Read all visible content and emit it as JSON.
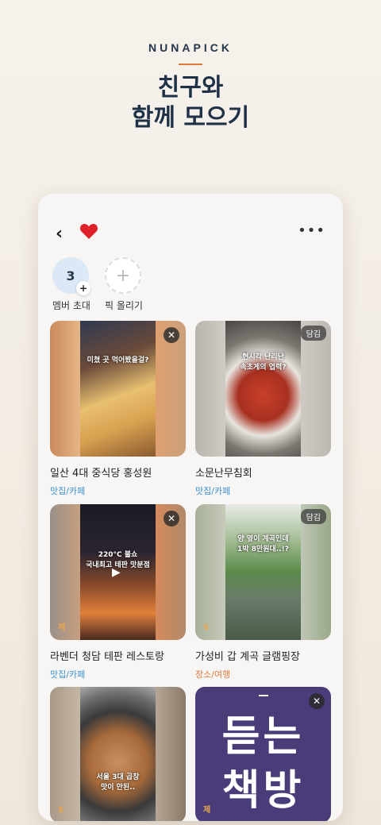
{
  "hero": {
    "brand": "NUNAPICK",
    "headline_line1": "친구와",
    "headline_line2": "함께 모으기",
    "accent_color": "#e07a3f"
  },
  "topbar": {
    "back_icon": "chevron-left-icon",
    "heart_icon": "heart-icon",
    "more_icon": "more-horizontal-icon"
  },
  "members": {
    "count": "3",
    "invite_label": "멤버 초대",
    "add_pick_label": "픽 올리기"
  },
  "cards": [
    {
      "title": "일산 4대 중식당 홍성원",
      "category": "맛집/카페",
      "category_color": "blue",
      "action": "close",
      "overlay": "미쳤 곳 먹어봤을걸?"
    },
    {
      "title": "소문난무침회",
      "category": "맛집/카페",
      "category_color": "blue",
      "action": "담김",
      "overlay1": "현시각 난리난",
      "overlay2": "속초게의 엽력?"
    },
    {
      "title": "라벤더 청담 테판 레스토랑",
      "category": "맛집/카페",
      "category_color": "blue",
      "action": "close",
      "badge": "제",
      "overlay1": "220°C 불쇼",
      "overlay2": "국내최고 테판 맛분점"
    },
    {
      "title": "가성비 갑 계곡 글램핑장",
      "category": "장소/여행",
      "category_color": "orange",
      "action": "담김",
      "badge": "S",
      "overlay1": "양 옆이 계곡인데",
      "overlay2": "1박 8만원대..!?"
    },
    {
      "title": "",
      "category": "",
      "action": "",
      "badge": "S",
      "overlay1": "서울 3대 곱창",
      "overlay2": "맛이 안된.."
    },
    {
      "title": "",
      "category": "",
      "action": "close",
      "badge": "제",
      "book_line1": "듣는",
      "book_line2": "책방"
    }
  ]
}
